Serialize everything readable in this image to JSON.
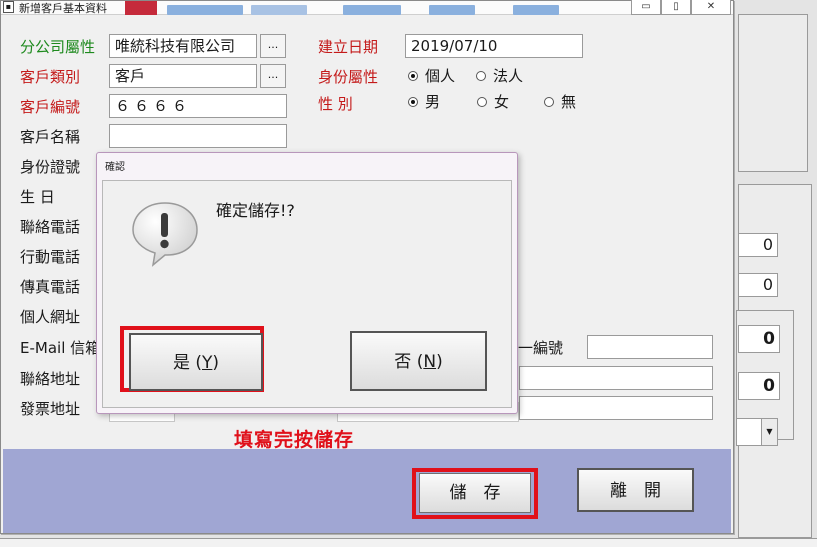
{
  "window": {
    "title": "新增客戶基本資料",
    "icon": "app-icon",
    "controls": {
      "minimize": "▭",
      "restore": "▯",
      "close": "✕"
    }
  },
  "form": {
    "branch": {
      "label": "分公司屬性",
      "value": "唯統科技有限公司"
    },
    "category": {
      "label": "客戶類別",
      "value": "客戶"
    },
    "code": {
      "label": "客戶編號",
      "value": "６６６６"
    },
    "name": {
      "label": "客戶名稱",
      "value": ""
    },
    "id_number": {
      "label": "身份證號"
    },
    "birthday": {
      "label": "生 日"
    },
    "phone": {
      "label": "聯絡電話"
    },
    "mobile": {
      "label": "行動電話"
    },
    "fax": {
      "label": "傳真電話"
    },
    "website": {
      "label": "個人網址"
    },
    "email": {
      "label": "E-Mail 信箱"
    },
    "contact_address": {
      "label": "聯絡地址"
    },
    "invoice_address": {
      "label": "發票地址"
    },
    "created_date": {
      "label": "建立日期",
      "value": "2019/07/10"
    },
    "identity": {
      "label": "身份屬性",
      "options": [
        "個人",
        "法人"
      ],
      "selected": "個人"
    },
    "gender": {
      "label": "性 別",
      "options": [
        "男",
        "女",
        "無"
      ],
      "selected": "男"
    },
    "unified_number_label": "一編號",
    "ellipsis": "..."
  },
  "background_values": {
    "v1": "0",
    "v2": "0",
    "v3": "0",
    "v4": "0"
  },
  "buttons": {
    "save": "儲　存",
    "leave": "離　開"
  },
  "instruction": "填寫完按儲存",
  "dialog": {
    "title": "確認",
    "message": "確定儲存!?",
    "icon": "question-exclamation-icon",
    "yes": {
      "text": "是 (",
      "key": "Y",
      "close": ")"
    },
    "no": {
      "text": "否 (",
      "key": "N",
      "close": ")"
    }
  },
  "colors": {
    "highlight": "#e0101a",
    "label_green": "#1e8a1e",
    "label_red": "#c41a1a",
    "button_bar": "#a0a6d3"
  }
}
